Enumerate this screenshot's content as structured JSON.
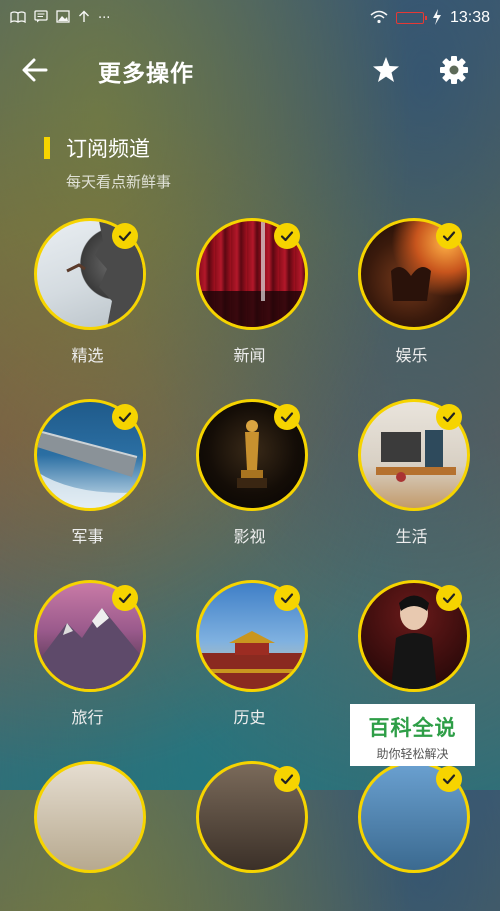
{
  "status_bar": {
    "time": "13:38",
    "notif_icons": [
      "reader-icon",
      "message-icon",
      "image-icon",
      "upload-icon"
    ],
    "more": "···"
  },
  "header": {
    "title": "更多操作",
    "back_icon": "back-arrow-icon",
    "star_icon": "star-icon",
    "settings_icon": "gear-icon"
  },
  "section": {
    "title": "订阅频道",
    "subtitle": "每天看点新鲜事"
  },
  "channels": [
    {
      "label": "精选",
      "subscribed": true
    },
    {
      "label": "新闻",
      "subscribed": true
    },
    {
      "label": "娱乐",
      "subscribed": true
    },
    {
      "label": "军事",
      "subscribed": true
    },
    {
      "label": "影视",
      "subscribed": true
    },
    {
      "label": "生活",
      "subscribed": true
    },
    {
      "label": "旅行",
      "subscribed": true
    },
    {
      "label": "历史",
      "subscribed": true
    }
  ],
  "watermark": {
    "title": "百科全说",
    "subtitle": "助你轻松解决"
  },
  "colors": {
    "accent": "#f6d400",
    "watermark_green": "#2e9e47"
  }
}
